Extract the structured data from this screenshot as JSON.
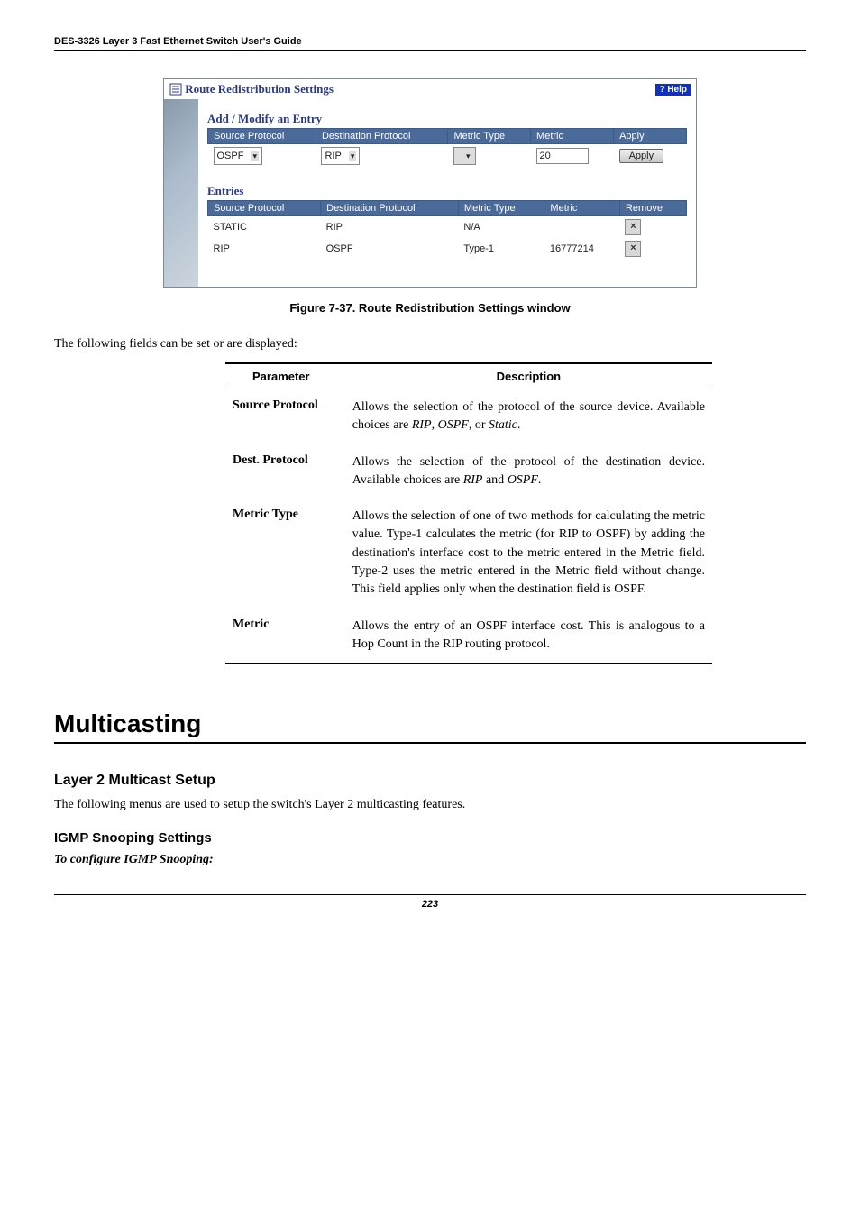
{
  "doc": {
    "header": "DES-3326 Layer 3 Fast Ethernet Switch User's Guide",
    "page_number": "223"
  },
  "screenshot": {
    "title": "Route Redistribution Settings",
    "help_label": "? Help",
    "add_section": "Add / Modify an Entry",
    "entries_section": "Entries",
    "add_headers": {
      "src": "Source Protocol",
      "dst": "Destination Protocol",
      "mtype": "Metric Type",
      "metric": "Metric",
      "apply": "Apply"
    },
    "add_row": {
      "src": "OSPF",
      "dst": "RIP",
      "mtype": "",
      "metric": "20",
      "apply_btn": "Apply"
    },
    "entries_headers": {
      "src": "Source Protocol",
      "dst": "Destination Protocol",
      "mtype": "Metric Type",
      "metric": "Metric",
      "remove": "Remove"
    },
    "entries_rows": [
      {
        "src": "STATIC",
        "dst": "RIP",
        "mtype": "N/A",
        "metric": ""
      },
      {
        "src": "RIP",
        "dst": "OSPF",
        "mtype": "Type-1",
        "metric": "16777214"
      }
    ],
    "remove_glyph": "×"
  },
  "figure_caption": "Figure 7-37.  Route Redistribution Settings window",
  "intro_text": "The following fields can be set or are displayed:",
  "param_table": {
    "head_param": "Parameter",
    "head_desc": "Description",
    "rows": [
      {
        "name": "Source Protocol",
        "desc": "Allows the selection of the protocol of the source device. Available choices are RIP, OSPF, or Static."
      },
      {
        "name": "Dest. Protocol",
        "desc": "Allows the selection of the protocol of the destination device. Available choices are RIP and OSPF."
      },
      {
        "name": "Metric Type",
        "desc": "Allows the selection of one of two methods for calculating the metric value. Type-1 calculates the metric (for RIP to OSPF) by adding the destination's interface cost to the metric entered in the Metric field. Type-2 uses the metric entered in the Metric field without change. This field applies only when the destination field is OSPF."
      },
      {
        "name": "Metric",
        "desc": "Allows the entry of an OSPF interface cost. This is analogous to a Hop Count in the RIP routing protocol."
      }
    ]
  },
  "h1": "Multicasting",
  "h2": "Layer 2 Multicast Setup",
  "body2": "The following menus are used to setup the switch's Layer 2 multicasting features.",
  "h3": "IGMP Snooping Settings",
  "italic_bold": "To configure IGMP Snooping:"
}
